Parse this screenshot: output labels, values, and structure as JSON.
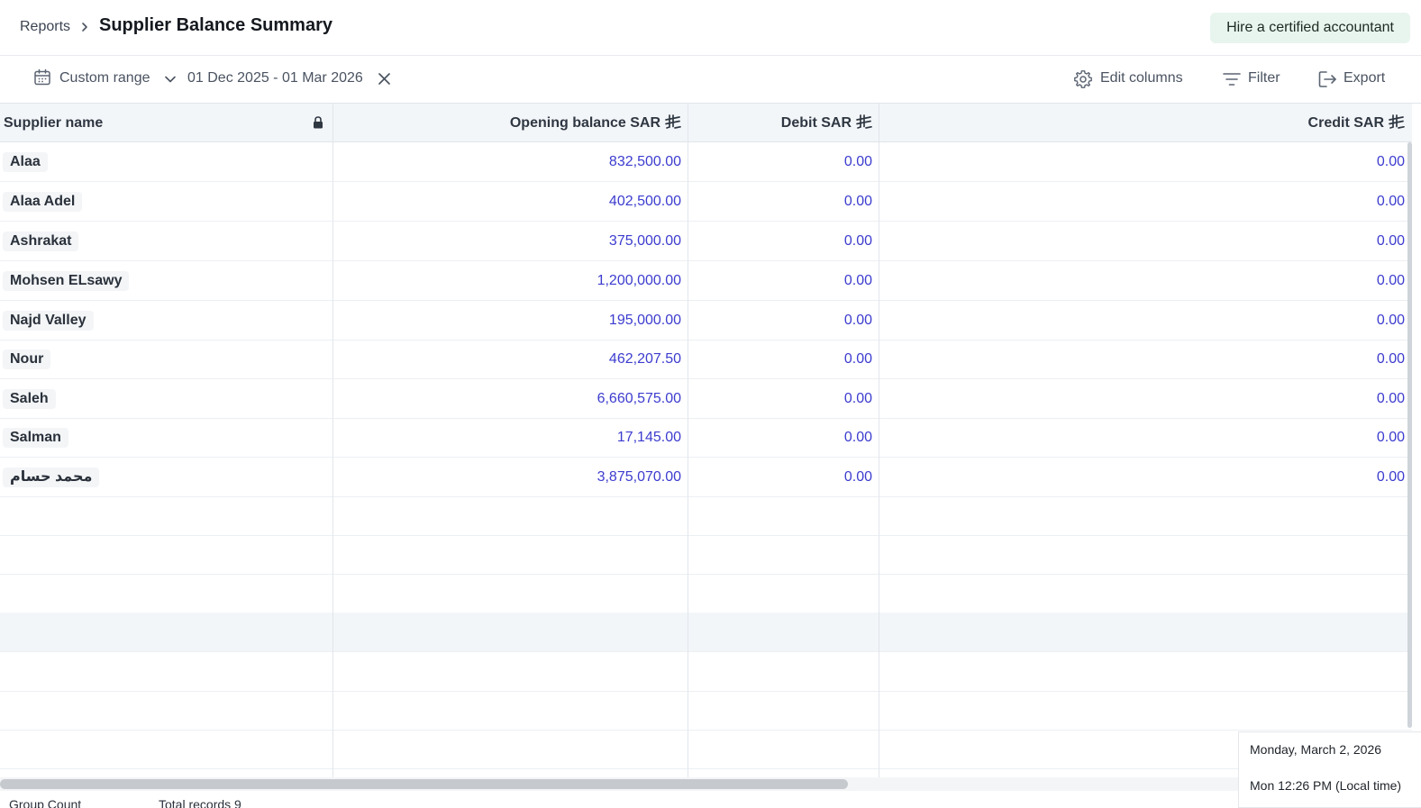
{
  "header": {
    "breadcrumb_root": "Reports",
    "title": "Supplier Balance Summary",
    "hire_button": "Hire a certified accountant"
  },
  "toolbar": {
    "range_label": "Custom range",
    "date_range": "01 Dec 2025 - 01 Mar 2026",
    "edit_columns": "Edit columns",
    "filter": "Filter",
    "export": "Export"
  },
  "table": {
    "columns": {
      "supplier_name": "Supplier name",
      "opening_balance": "Opening balance  SAR",
      "debit": "Debit  SAR",
      "credit": "Credit  SAR"
    },
    "rows": [
      {
        "name": "Alaa",
        "opening": "832,500.00",
        "debit": "0.00",
        "credit": "0.00"
      },
      {
        "name": "Alaa Adel",
        "opening": "402,500.00",
        "debit": "0.00",
        "credit": "0.00"
      },
      {
        "name": "Ashrakat",
        "opening": "375,000.00",
        "debit": "0.00",
        "credit": "0.00"
      },
      {
        "name": "Mohsen ELsawy",
        "opening": "1,200,000.00",
        "debit": "0.00",
        "credit": "0.00"
      },
      {
        "name": "Najd Valley",
        "opening": "195,000.00",
        "debit": "0.00",
        "credit": "0.00"
      },
      {
        "name": "Nour",
        "opening": "462,207.50",
        "debit": "0.00",
        "credit": "0.00"
      },
      {
        "name": "Saleh",
        "opening": "6,660,575.00",
        "debit": "0.00",
        "credit": "0.00"
      },
      {
        "name": "Salman",
        "opening": "17,145.00",
        "debit": "0.00",
        "credit": "0.00"
      },
      {
        "name": "محمد حسام",
        "opening": "3,875,070.00",
        "debit": "0.00",
        "credit": "0.00"
      }
    ]
  },
  "footer": {
    "group_text": "Group Count",
    "total_text": "Total records 9"
  },
  "clock": {
    "date": "Monday, March 2, 2026",
    "time": "Mon 12:26 PM (Local time)"
  },
  "colors": {
    "amount": "#3c3ccf",
    "hire_bg": "#e8f5ee",
    "header_bg": "#f3f6f9"
  }
}
